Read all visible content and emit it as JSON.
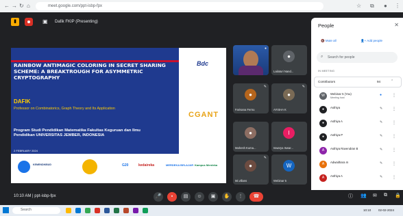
{
  "browser": {
    "url": "meet.google.com/ppt-isbp-fpx",
    "nav": [
      "←",
      "→",
      "↻",
      "⌂"
    ]
  },
  "meet": {
    "presenter_label": "Dafik FKIP (Presenting)",
    "meeting_time": "10:10 AM",
    "meeting_code": "ppt-isbp-fpx"
  },
  "slide": {
    "title": "RAINBOW ANTIMAGIC COLORING IN SECRET SHARING SCHEME: A BREAKTROUGH FOR ASYMMETRIC CRYPTOGRAPHY",
    "author": "DAFIK",
    "role": "Professor on Combinatorics, Graph Theory and Its Application",
    "institution": "Program Studi Pendidikan Matematika Fakultas Keguruan dan Ilmu Pendidikan UNIVERSITAS JEMBER, INDONESIA",
    "date": "2 FEBRUARY 2024",
    "logo_bdc": "Bdc",
    "logo_cgant": "CGANT",
    "footer_logos": [
      "KEMENDIKBUD",
      "G20",
      "kedaireka",
      "MERDEKA BELAJAR",
      "Kampus Merdeka"
    ]
  },
  "tiles": [
    {
      "name": ""
    },
    {
      "name": "Lailaturi Nand..."
    },
    {
      "name": "Farisana Fernu"
    },
    {
      "name": "AYISHA K"
    },
    {
      "name": "Mahesh Kuma..."
    },
    {
      "name": "Iswarya Iswar..."
    },
    {
      "name": "Mi.villans"
    },
    {
      "name": "Webinar 5"
    }
  ],
  "panel": {
    "title": "People",
    "mute_all": "Mute all",
    "add_people": "Add people",
    "search_placeholder": "Search for people",
    "section": "IN MEETING",
    "contributors_label": "Contributors",
    "contributors_count": "94",
    "people": [
      {
        "name": "Webinar 5 (You)",
        "sub": "Meeting host",
        "color": "#5f6368",
        "initial": "W"
      },
      {
        "name": "Asthiya",
        "sub": "",
        "color": "#202124",
        "initial": "A"
      },
      {
        "name": "Asthiya A",
        "sub": "",
        "color": "#202124",
        "initial": "A"
      },
      {
        "name": "Asthiya P",
        "sub": "",
        "color": "#202124",
        "initial": "A"
      },
      {
        "name": "Asthiya Ravendran B",
        "sub": "",
        "color": "#8e24aa",
        "initial": "A"
      },
      {
        "name": "Adwaithara m",
        "sub": "",
        "color": "#e8710a",
        "initial": "A"
      },
      {
        "name": "Asthiya A",
        "sub": "",
        "color": "#c5221f",
        "initial": "A"
      }
    ]
  },
  "taskbar": {
    "search": "Search",
    "time": "10:10",
    "date": "02-02-2024"
  },
  "colors": {
    "meet_bg": "#202124",
    "slide_blue": "#1f3a8f",
    "slide_yellow": "#ffcc00",
    "end_call": "#ea4335"
  }
}
